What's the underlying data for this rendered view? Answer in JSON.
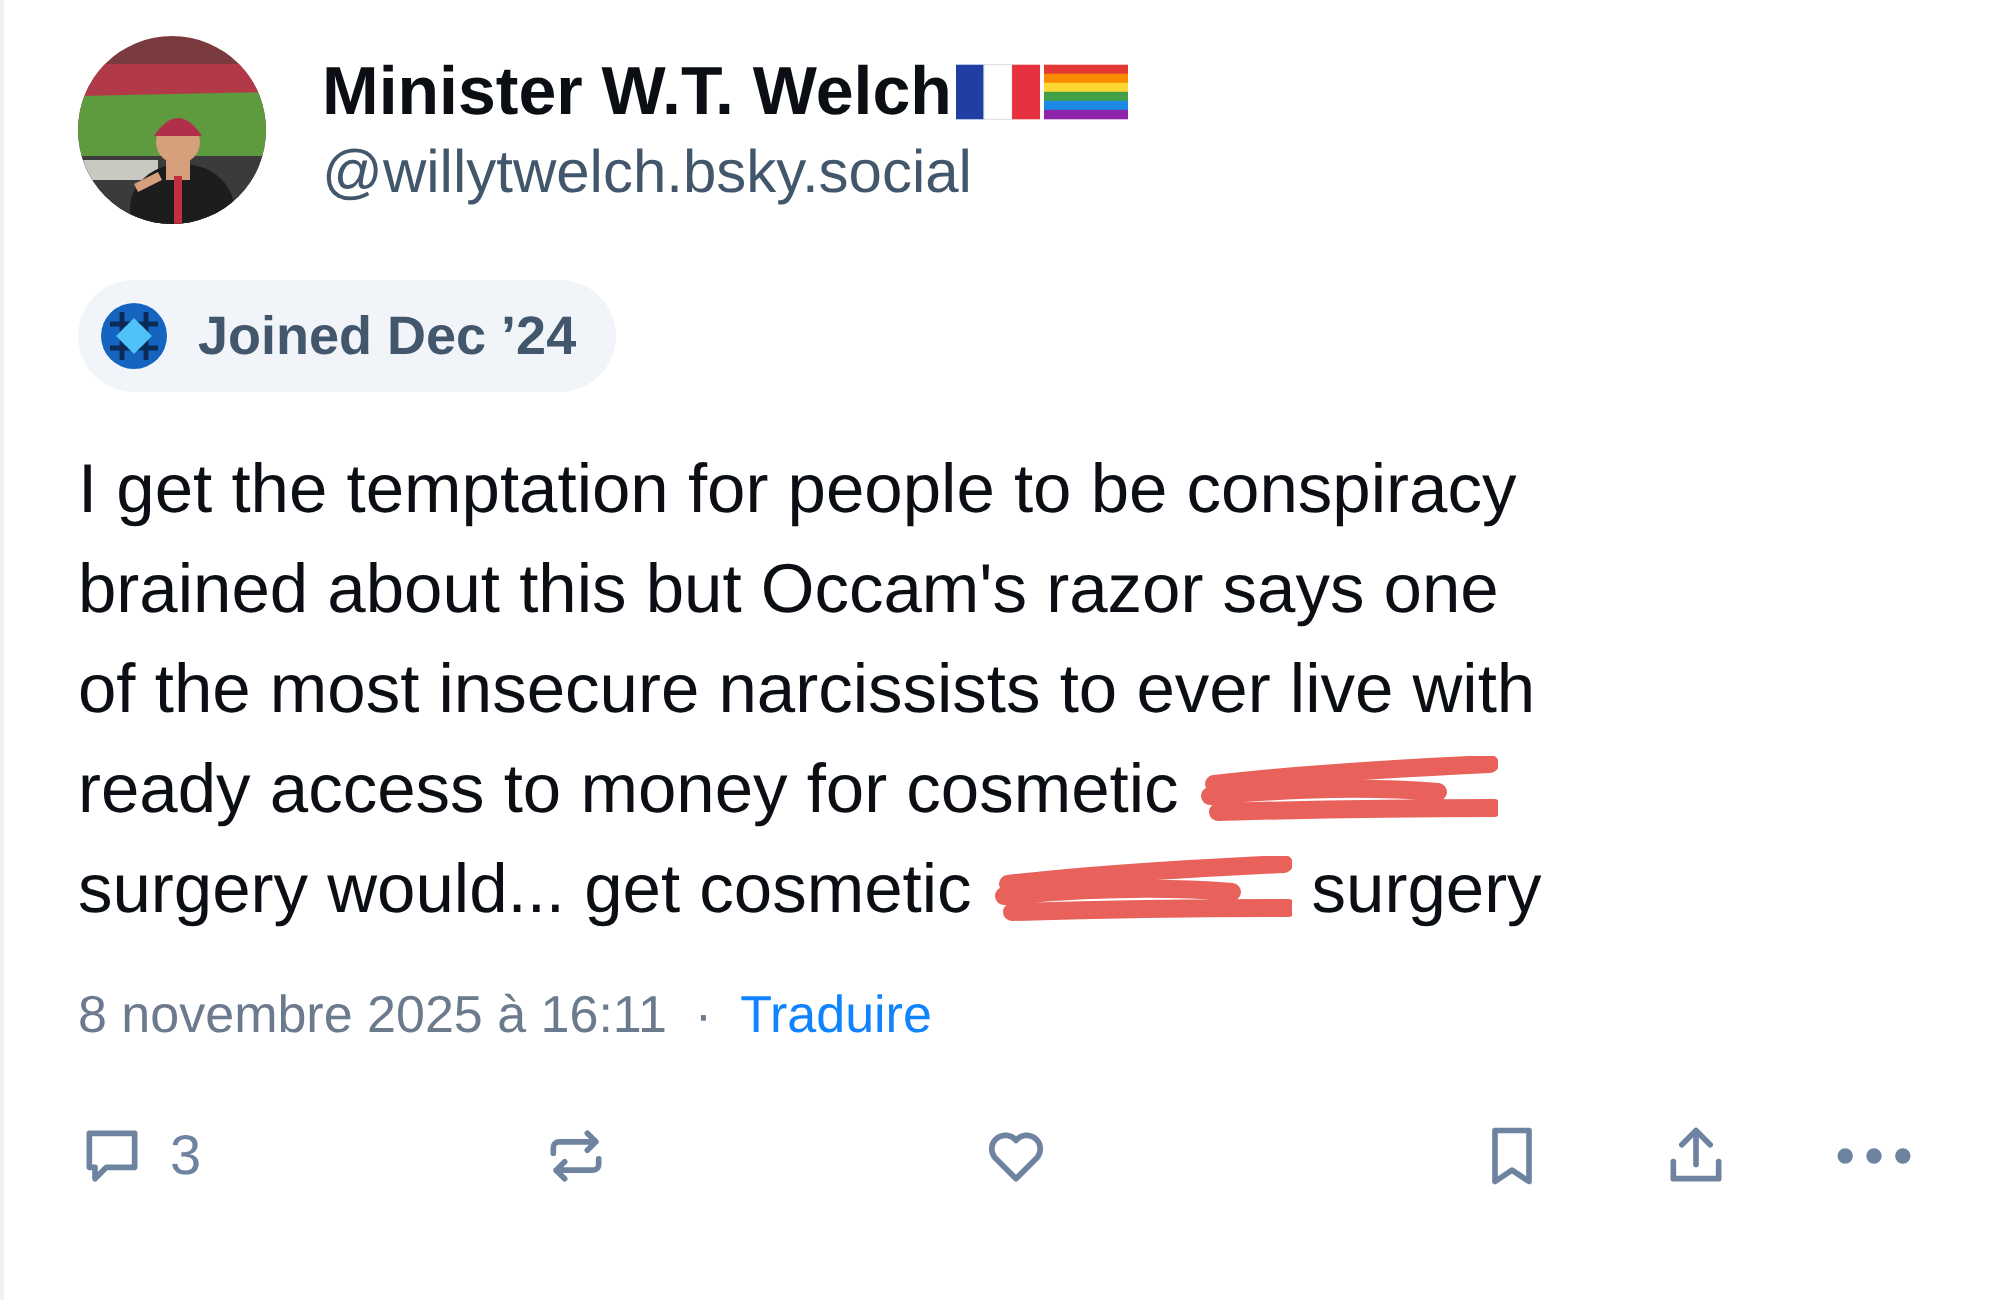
{
  "author": {
    "display_name": "Minister W.T. Welch",
    "handle": "@willytwelch.bsky.social"
  },
  "badge": {
    "label": "Joined Dec ’24"
  },
  "post": {
    "lines": [
      [
        {
          "kind": "text",
          "text": "I get the temptation for people to be conspiracy"
        }
      ],
      [
        {
          "kind": "text",
          "text": "brained about this but Occam's razor says one"
        }
      ],
      [
        {
          "kind": "text",
          "text": "of the most insecure narcissists to ever live with"
        }
      ],
      [
        {
          "kind": "text",
          "text": "ready access to money for cosmetic"
        },
        {
          "kind": "scribble"
        }
      ],
      [
        {
          "kind": "text",
          "text": "surgery would... get cosmetic"
        },
        {
          "kind": "scribble"
        },
        {
          "kind": "text",
          "text": "surgery"
        }
      ]
    ]
  },
  "meta": {
    "timestamp": "8 novembre 2025 à 16:11",
    "separator": "·",
    "translate": "Traduire"
  },
  "actions": {
    "reply_count": "3"
  }
}
